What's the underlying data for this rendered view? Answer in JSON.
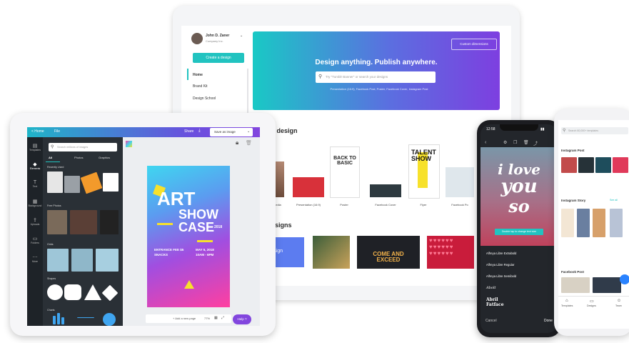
{
  "desktop": {
    "user_name": "John D. Zaner",
    "user_sub": "Company Inc.",
    "create_button": "Create a design",
    "nav": [
      "Home",
      "Brand Kit",
      "Design School"
    ],
    "hero_title": "Design anything. Publish anywhere.",
    "search_placeholder": "Try \"Tumblr Banner\" or search your designs",
    "hint": "Presentation (16:9), Facebook Post, Poster, Facebook Cover, Instagram Post",
    "custom_dimensions": "Custom dimensions",
    "create_section": "a design",
    "designs_section": "esigns",
    "templates": [
      "edia",
      "Presentation (16:9)",
      "Poster",
      "Facebook Cover",
      "Flyer",
      "Facebook Po"
    ],
    "poster_text": "BACK TO BASIC",
    "flyer_text": "TALENT SHOW",
    "design_item": "r Design",
    "come_exceed": "COME AND EXCEED"
  },
  "tablet": {
    "back": "< Home",
    "file": "File",
    "share": "Share",
    "save_as_image": "Save as image",
    "search_placeholder": "Search millions of images",
    "tabs": [
      "All",
      "Photos",
      "Graphics"
    ],
    "sections": [
      "Recently Used",
      "Free Photos",
      "Grids",
      "Shapes",
      "Charts"
    ],
    "rail": [
      "Templates",
      "Elements",
      "Text",
      "Background",
      "Uploads",
      "Folders",
      "More"
    ],
    "poster_line1": "ART",
    "poster_line2": "SHOW",
    "poster_line3": "CASE",
    "poster_year": "2018",
    "poster_small1": "ENTRANCE FEE $5",
    "poster_small2": "SNACKS",
    "poster_date": "MAY 5, 2018",
    "poster_time": "10AM - 6PM",
    "add_page": "+ Add a new page",
    "zoom": "77%",
    "help": "Help  ?"
  },
  "phone1": {
    "time": "12:58",
    "love1": "i love",
    "love2": "you",
    "love3": "so",
    "banner": "Double tap to change text size",
    "fonts": [
      "Alfreya Libre Extrabold",
      "Alfreya Libre Regular",
      "Alfreya Libre Semibold",
      "Abolt",
      "Abril Fatface"
    ],
    "cancel": "Cancel",
    "done": "Done"
  },
  "phone2": {
    "search_placeholder": "Search 60,000+ templates",
    "sections": [
      "Instagram Post",
      "Instagram Story",
      "Facebook Post"
    ],
    "see_all": "See all",
    "bottom_nav": [
      "Templates",
      "Designs",
      "Team"
    ]
  },
  "colors": {
    "teal": "#21c3c0",
    "purple": "#7d3fe0",
    "pink": "#ff3fa0",
    "dark": "#2a3036"
  }
}
